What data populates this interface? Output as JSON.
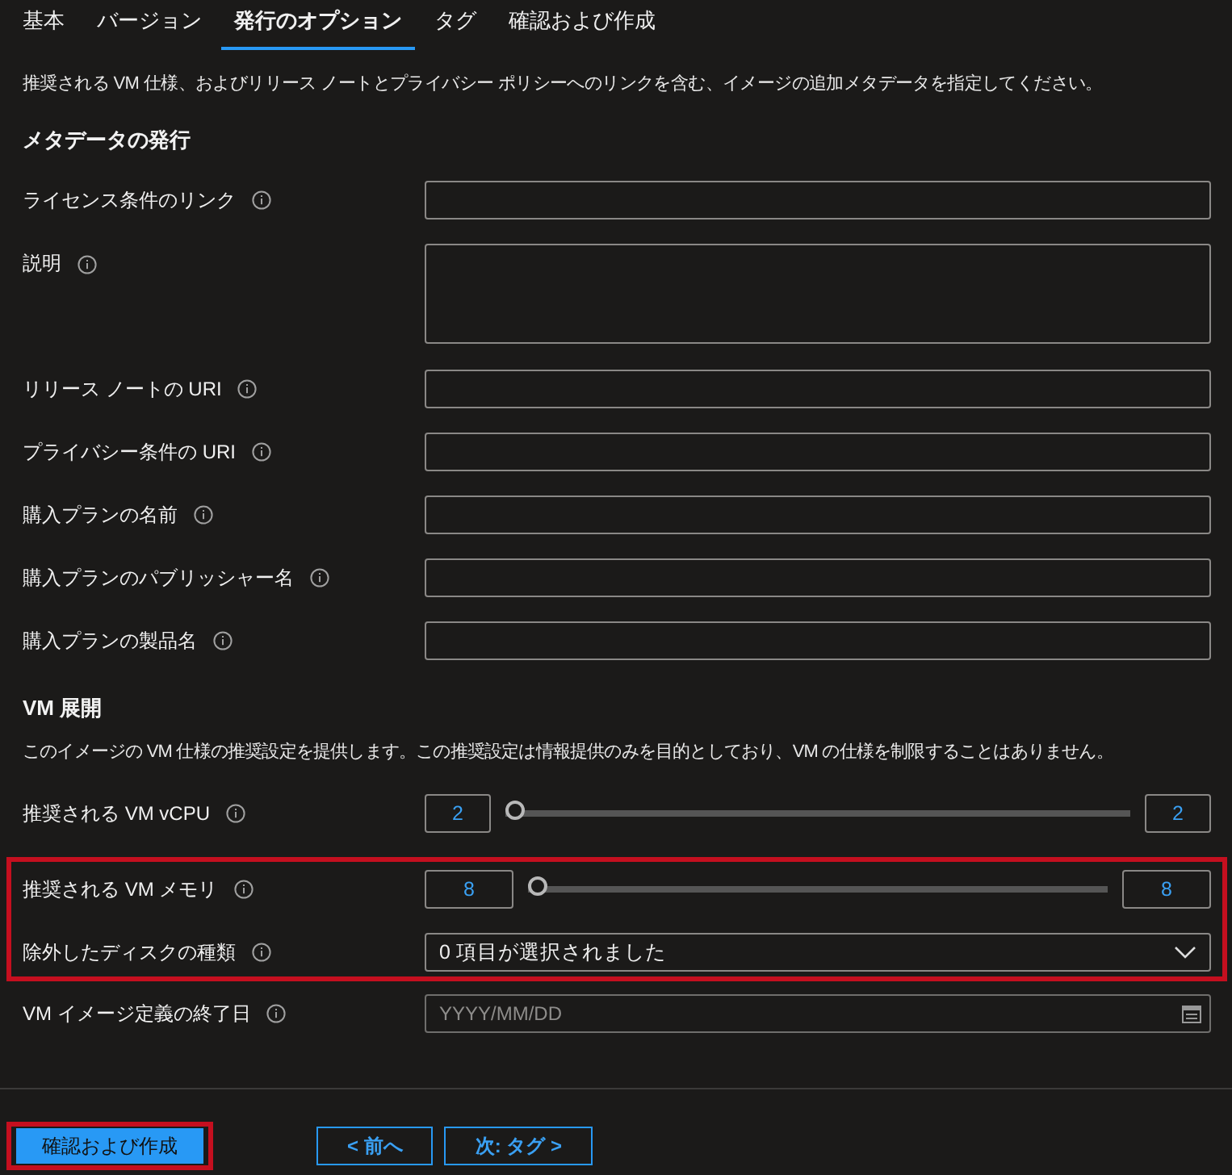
{
  "tabs": [
    {
      "label": "基本",
      "selected": false
    },
    {
      "label": "バージョン",
      "selected": false
    },
    {
      "label": "発行のオプション",
      "selected": true
    },
    {
      "label": "タグ",
      "selected": false
    },
    {
      "label": "確認および作成",
      "selected": false
    }
  ],
  "intro": "推奨される VM 仕様、およびリリース ノートとプライバシー ポリシーへのリンクを含む、イメージの追加メタデータを指定してください。",
  "sections": [
    {
      "heading": "メタデータの発行",
      "rows": [
        {
          "kind": "text",
          "label": "ライセンス条件のリンク"
        },
        {
          "kind": "textarea",
          "label": "説明"
        },
        {
          "kind": "text",
          "label": "リリース ノートの URI"
        },
        {
          "kind": "text",
          "label": "プライバシー条件の URI"
        },
        {
          "kind": "text",
          "label": "購入プランの名前"
        },
        {
          "kind": "text",
          "label": "購入プランのパブリッシャー名"
        },
        {
          "kind": "text",
          "label": "購入プランの製品名"
        }
      ]
    },
    {
      "heading": "VM 展開",
      "description": "このイメージの VM 仕様の推奨設定を提供します。この推奨設定は情報提供のみを目的としており、VM の仕様を制限することはありません。",
      "rows": [
        {
          "kind": "slider",
          "label": "推奨される VM vCPU",
          "min_value": "2",
          "level": 0,
          "max_value": "2"
        },
        {
          "kind": "slider",
          "label": "推奨される VM メモリ",
          "min_value": "8",
          "level": 0,
          "max_value": "8",
          "highlighted": true
        },
        {
          "kind": "dropdown",
          "label": "除外したディスクの種類",
          "value": "0 項目が選択されました",
          "highlighted": true
        },
        {
          "kind": "date",
          "label": "VM イメージ定義の終了日",
          "placeholder": "YYYY/MM/DD"
        }
      ]
    }
  ],
  "buttons": [
    {
      "label": "確認および作成",
      "kind": "primary",
      "highlighted": true
    },
    {
      "label": "< 前へ",
      "kind": "secondary"
    },
    {
      "label": "次: タグ >",
      "kind": "secondary"
    }
  ]
}
